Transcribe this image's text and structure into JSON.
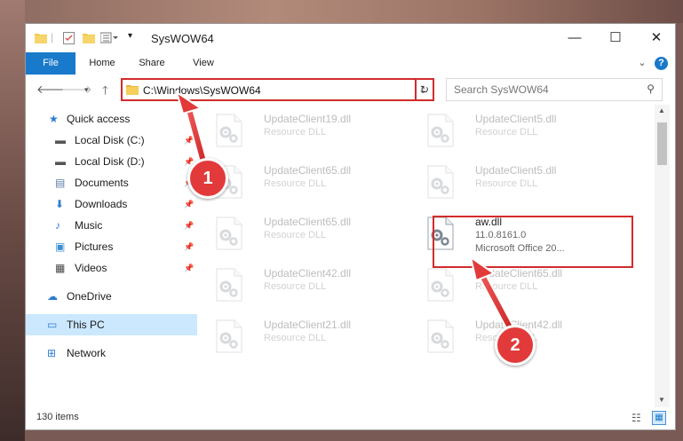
{
  "window": {
    "title": "SysWOW64",
    "minimize": "—",
    "maximize": "☐",
    "close": "✕"
  },
  "ribbon": {
    "tabs": [
      "File",
      "Home",
      "Share",
      "View"
    ],
    "expand": "⌄",
    "help": "?"
  },
  "address": {
    "path": "C:\\Windows\\SysWOW64",
    "dropdown": "⌄",
    "refresh": "↻"
  },
  "search": {
    "placeholder": "Search SysWOW64"
  },
  "sidebar": {
    "items": [
      {
        "label": "Quick access",
        "icon": "star-icon",
        "glyph": "★",
        "color": "#2b7cd3",
        "pinned": false
      },
      {
        "label": "Local Disk (C:)",
        "icon": "drive-icon",
        "glyph": "▬",
        "color": "#555555",
        "pinned": true
      },
      {
        "label": "Local Disk (D:)",
        "icon": "drive-icon",
        "glyph": "▬",
        "color": "#555555",
        "pinned": true
      },
      {
        "label": "Documents",
        "icon": "document-icon",
        "glyph": "▤",
        "color": "#5b7fa6",
        "pinned": true
      },
      {
        "label": "Downloads",
        "icon": "download-icon",
        "glyph": "⬇",
        "color": "#2b7cd3",
        "pinned": true
      },
      {
        "label": "Music",
        "icon": "music-icon",
        "glyph": "♪",
        "color": "#2b7cd3",
        "pinned": true
      },
      {
        "label": "Pictures",
        "icon": "pictures-icon",
        "glyph": "▣",
        "color": "#3b8fd6",
        "pinned": true
      },
      {
        "label": "Videos",
        "icon": "video-icon",
        "glyph": "▦",
        "color": "#444444",
        "pinned": true
      },
      {
        "label": "OneDrive",
        "icon": "cloud-icon",
        "glyph": "☁",
        "color": "#2b7cd3",
        "pinned": false
      },
      {
        "label": "This PC",
        "icon": "computer-icon",
        "glyph": "▭",
        "color": "#2b7cd3",
        "pinned": false,
        "selected": true
      },
      {
        "label": "Network",
        "icon": "network-icon",
        "glyph": "⊞",
        "color": "#2b7cd3",
        "pinned": false
      }
    ]
  },
  "files": [
    {
      "name": "UpdateClient19.dll",
      "desc": "Resource DLL",
      "faded": true
    },
    {
      "name": "UpdateClient5.dll",
      "desc": "Resource DLL",
      "faded": true
    },
    {
      "name": "UpdateClient65.dll",
      "desc": "Resource DLL",
      "faded": true
    },
    {
      "name": "UpdateClient5.dll",
      "desc": "Resource DLL",
      "faded": true
    },
    {
      "name": "UpdateClient65.dll",
      "desc": "Resource DLL",
      "faded": true
    },
    {
      "name": "aw.dll",
      "desc": "11.0.8161.0",
      "desc2": "Microsoft Office 20...",
      "faded": false
    },
    {
      "name": "UpdateClient42.dll",
      "desc": "Resource DLL",
      "faded": true
    },
    {
      "name": "UpdateClient65.dll",
      "desc": "Resource DLL",
      "faded": true
    },
    {
      "name": "UpdateClient21.dll",
      "desc": "Resource DLL",
      "faded": true
    },
    {
      "name": "UpdateClient42.dll",
      "desc": "Resource DLL",
      "faded": true
    }
  ],
  "status": {
    "items": "130 items"
  },
  "annotations": {
    "step1": "1",
    "step2": "2",
    "color": "#e23a3a"
  }
}
